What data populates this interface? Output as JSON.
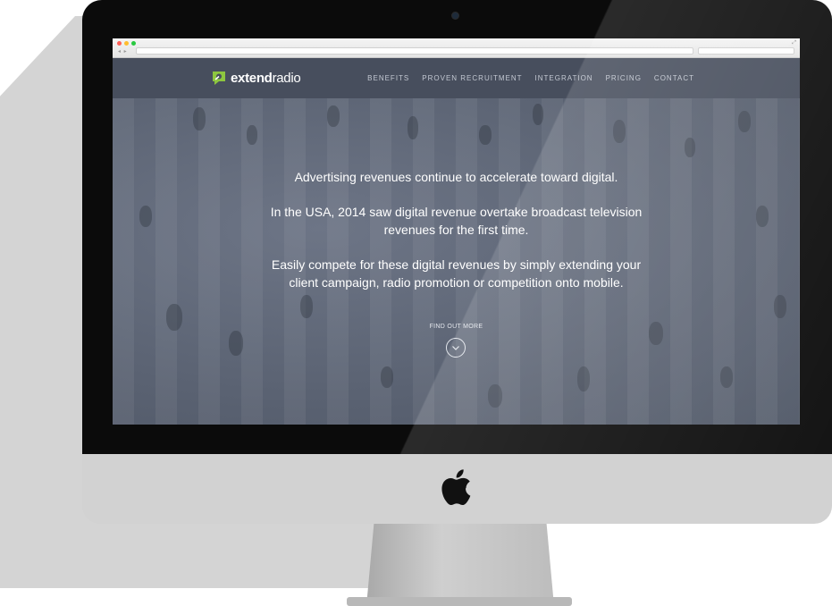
{
  "browser": {
    "url_text": "",
    "search_placeholder": "",
    "dots": [
      "#ff5f57",
      "#ffbd2e",
      "#28c940"
    ]
  },
  "site": {
    "logo": {
      "prefix": "extend",
      "suffix": "radio",
      "accent": "#8dc63f"
    },
    "nav": [
      {
        "label": "BENEFITS"
      },
      {
        "label": "PROVEN RECRUITMENT"
      },
      {
        "label": "INTEGRATION"
      },
      {
        "label": "PRICING"
      },
      {
        "label": "CONTACT"
      }
    ]
  },
  "hero": {
    "line1": "Advertising revenues continue to accelerate toward digital.",
    "line2a": "In the USA, 2014 saw digital revenue overtake broadcast television",
    "line2b": "revenues for the first time.",
    "line3a": "Easily compete for these digital revenues by simply extending your",
    "line3b": "client campaign, radio promotion or competition onto mobile.",
    "cta": "FIND OUT MORE"
  },
  "colors": {
    "header_bg": "#474e5d",
    "hero_overlay": "#5a6272",
    "bezel": "#0b0b0b",
    "chin": "#d2d2d2"
  }
}
